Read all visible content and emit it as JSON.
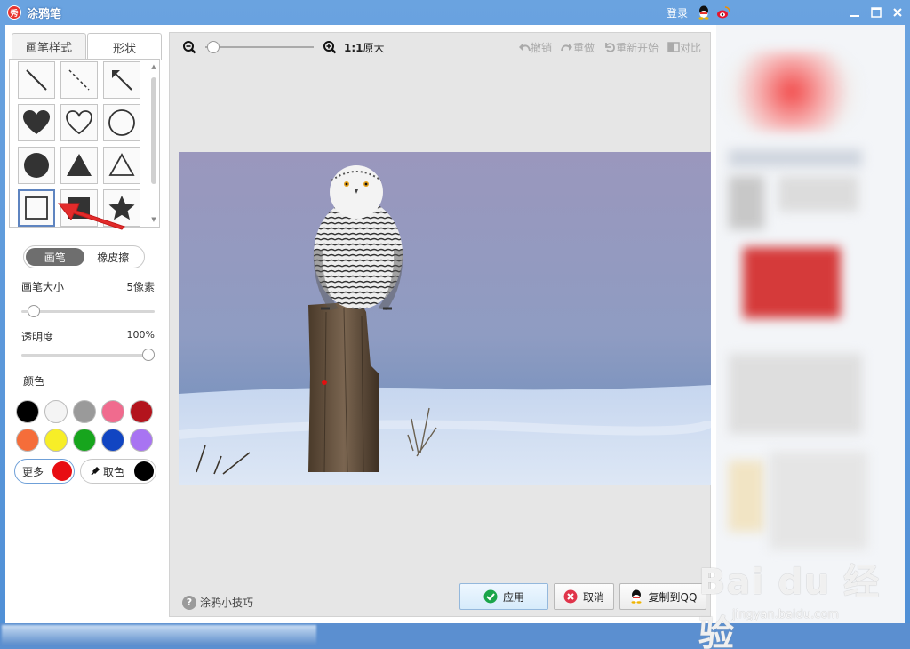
{
  "window": {
    "app_icon_glyph": "秀",
    "title": "涂鸦笔",
    "login": "登录",
    "icons": [
      "qq-icon",
      "weibo-icon"
    ],
    "controls": [
      "minimize-icon",
      "maximize-icon",
      "close-icon"
    ]
  },
  "left_panel": {
    "tabs": [
      {
        "label": "画笔样式",
        "active": false
      },
      {
        "label": "形状",
        "active": true
      }
    ],
    "shapes": [
      {
        "name": "line"
      },
      {
        "name": "dashed-line"
      },
      {
        "name": "arrow-line"
      },
      {
        "name": "heart-filled"
      },
      {
        "name": "heart-outline"
      },
      {
        "name": "circle-outline"
      },
      {
        "name": "circle-filled"
      },
      {
        "name": "triangle-filled"
      },
      {
        "name": "triangle-outline"
      },
      {
        "name": "square-outline",
        "selected": true
      },
      {
        "name": "square-filled"
      },
      {
        "name": "star-filled"
      }
    ],
    "mode": {
      "brush": "画笔",
      "eraser": "橡皮擦",
      "active": "brush"
    },
    "brush_size": {
      "label": "画笔大小",
      "value": "5像素",
      "level": 0.05
    },
    "opacity": {
      "label": "透明度",
      "value": "100%",
      "level": 1.0
    },
    "colors_label": "颜色",
    "swatches": [
      "#000000",
      "#f4f4f4",
      "#9a9a9a",
      "#f06b8e",
      "#b3141d",
      "#f56d3a",
      "#f7ee27",
      "#17a51d",
      "#1145c2",
      "#a874f2"
    ],
    "more_label": "更多",
    "more_color": "#e80d12",
    "pick_label": "取色",
    "pick_color": "#000000"
  },
  "toolbar": {
    "zoom_ratio": "1:1",
    "zoom_label": "原大",
    "undo": "撤销",
    "redo": "重做",
    "restart": "重新开始",
    "compare": "对比"
  },
  "bottom": {
    "tips": "涂鸦小技巧",
    "apply": "应用",
    "cancel": "取消",
    "copy_qq": "复制到QQ"
  },
  "watermark": {
    "logo": "Bai du 经验",
    "sub": "jingyan.baidu.com"
  }
}
